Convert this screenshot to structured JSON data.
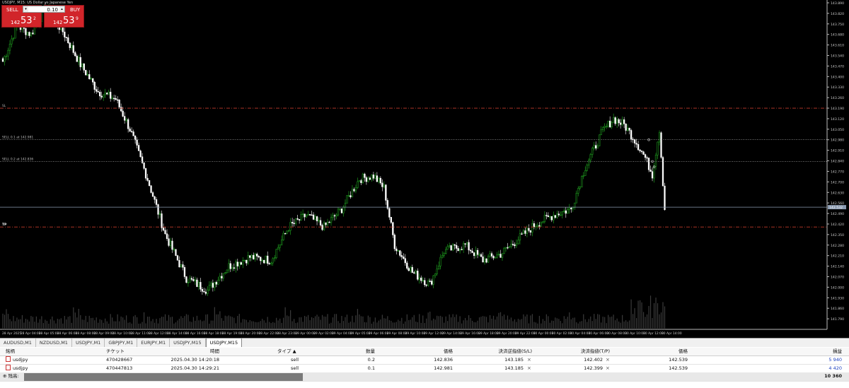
{
  "window_title": "USDJPY, M15: US Dollar vs Japanese Yen",
  "trade_panel": {
    "sell_label": "SELL",
    "buy_label": "BUY",
    "lot": "0.10",
    "sell_price_small": "142",
    "sell_price_big": "53",
    "sell_price_sup": "2",
    "buy_price_small": "142",
    "buy_price_big": "53",
    "buy_price_sup": "9",
    "color": "#d1252a"
  },
  "chart_data": {
    "type": "candlestick",
    "symbol": "USDJPY",
    "timeframe": "M15",
    "y_range": [
      141.72,
      143.89
    ],
    "y_ticks": [
      "143.890",
      "143.820",
      "143.750",
      "143.680",
      "143.610",
      "143.540",
      "143.470",
      "143.400",
      "143.330",
      "143.260",
      "143.190",
      "143.120",
      "143.050",
      "142.980",
      "142.910",
      "142.840",
      "142.770",
      "142.700",
      "142.630",
      "142.560",
      "142.490",
      "142.420",
      "142.350",
      "142.280",
      "142.210",
      "142.140",
      "142.070",
      "142.000",
      "141.930",
      "141.860",
      "141.790"
    ],
    "x_ticks": [
      "28 Apr 2025",
      "28 Apr 04:00",
      "28 Apr 05:00",
      "28 Apr 06:00",
      "28 Apr 08:00",
      "28 Apr 09:00",
      "28 Apr 10:00",
      "28 Apr 11:00",
      "28 Apr 12:00",
      "28 Apr 14:00",
      "28 Apr 16:00",
      "28 Apr 18:00",
      "28 Apr 19:00",
      "28 Apr 20:00",
      "28 Apr 22:00",
      "28 Apr 23:00",
      "29 Apr 00:00",
      "29 Apr 02:00",
      "29 Apr 04:00",
      "29 Apr 05:00",
      "29 Apr 06:00",
      "29 Apr 08:00",
      "29 Apr 10:00",
      "29 Apr 12:00",
      "29 Apr 14:00",
      "29 Apr 16:00",
      "29 Apr 18:00",
      "29 Apr 20:00",
      "29 Apr 22:00",
      "30 Apr 00:00",
      "30 Apr 02:00",
      "30 Apr 04:00",
      "30 Apr 06:00",
      "30 Apr 08:00",
      "30 Apr 10:00",
      "30 Apr 12:00",
      "30 Apr 14:00"
    ],
    "key_points": [
      {
        "i": 0,
        "v": 143.5
      },
      {
        "i": 8,
        "v": 143.74
      },
      {
        "i": 16,
        "v": 143.68
      },
      {
        "i": 24,
        "v": 143.86
      },
      {
        "i": 34,
        "v": 143.7
      },
      {
        "i": 44,
        "v": 143.48
      },
      {
        "i": 54,
        "v": 143.3
      },
      {
        "i": 64,
        "v": 143.25
      },
      {
        "i": 72,
        "v": 143.05
      },
      {
        "i": 82,
        "v": 142.72
      },
      {
        "i": 92,
        "v": 142.35
      },
      {
        "i": 104,
        "v": 142.06
      },
      {
        "i": 116,
        "v": 141.98
      },
      {
        "i": 128,
        "v": 142.14
      },
      {
        "i": 140,
        "v": 142.2
      },
      {
        "i": 152,
        "v": 142.18
      },
      {
        "i": 162,
        "v": 142.4
      },
      {
        "i": 172,
        "v": 142.48
      },
      {
        "i": 182,
        "v": 142.4
      },
      {
        "i": 192,
        "v": 142.52
      },
      {
        "i": 202,
        "v": 142.72
      },
      {
        "i": 210,
        "v": 142.74
      },
      {
        "i": 216,
        "v": 142.66
      },
      {
        "i": 222,
        "v": 142.28
      },
      {
        "i": 232,
        "v": 142.1
      },
      {
        "i": 242,
        "v": 142.02
      },
      {
        "i": 250,
        "v": 142.24
      },
      {
        "i": 262,
        "v": 142.28
      },
      {
        "i": 272,
        "v": 142.18
      },
      {
        "i": 282,
        "v": 142.22
      },
      {
        "i": 292,
        "v": 142.32
      },
      {
        "i": 302,
        "v": 142.42
      },
      {
        "i": 312,
        "v": 142.48
      },
      {
        "i": 322,
        "v": 142.52
      },
      {
        "i": 330,
        "v": 142.8
      },
      {
        "i": 340,
        "v": 143.04
      },
      {
        "i": 346,
        "v": 143.12
      },
      {
        "i": 352,
        "v": 143.08
      },
      {
        "i": 358,
        "v": 142.98
      },
      {
        "i": 364,
        "v": 142.86
      },
      {
        "i": 368,
        "v": 142.75
      },
      {
        "i": 372,
        "v": 143.05
      },
      {
        "i": 375,
        "v": 142.52
      }
    ],
    "bar_count": 376,
    "current_price": "142.532",
    "lines": [
      {
        "name": "SL",
        "value": 143.19,
        "color": "#c0392b"
      },
      {
        "name": "SELL 0.1 at 142.981",
        "label": "SELL 0.1 at 142.981",
        "value": 142.981,
        "color": "#888888"
      },
      {
        "name": "SELL 0.2 at 142.836",
        "label": "SELL 0.2 at 142.836",
        "value": 142.836,
        "color": "#888888"
      },
      {
        "name": "TP",
        "value": 142.4,
        "color": "#c0392b"
      },
      {
        "name": "price",
        "value": 142.532,
        "color": "#8a9ab0"
      }
    ],
    "up_color": "#22b022",
    "down_color": "#ffffff"
  },
  "tabs": [
    {
      "label": "AUDUSD,M1"
    },
    {
      "label": "NZDUSD,M1"
    },
    {
      "label": "USDJPY,M1"
    },
    {
      "label": "GBPJPY,M1"
    },
    {
      "label": "EURJPY,M1"
    },
    {
      "label": "USDJPY,M15"
    },
    {
      "label": "USDJPY,M15",
      "active": true
    }
  ],
  "table": {
    "headers": [
      "銘柄",
      "チケット",
      "時間",
      "タイプ ▲",
      "数量",
      "価格",
      "決済逆指値(S/L)",
      "決済指値(T/P)",
      "価格",
      "損益"
    ],
    "rows": [
      {
        "symbol": "usdjpy",
        "ticket": "470428667",
        "time": "2025.04.30 14:20:18",
        "type": "sell",
        "volume": "0.2",
        "price": "142.836",
        "sl": "143.185",
        "tp": "142.402",
        "cur": "142.539",
        "profit": "5 940"
      },
      {
        "symbol": "usdjpy",
        "ticket": "470447813",
        "time": "2025.04.30 14:29:21",
        "type": "sell",
        "volume": "0.1",
        "price": "142.981",
        "sl": "143.185",
        "tp": "142.399",
        "cur": "142.539",
        "profit": "4 420"
      }
    ],
    "balance_label": "残高:",
    "total": "10 360",
    "close_icon": "×"
  }
}
